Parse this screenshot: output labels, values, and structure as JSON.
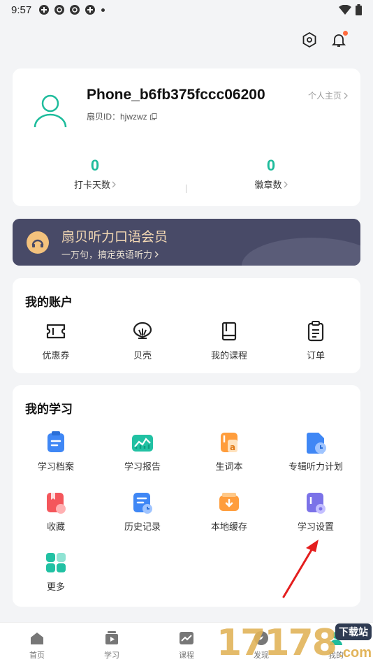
{
  "status_bar": {
    "time": "9:57"
  },
  "profile": {
    "username": "Phone_b6fb375fccc06200",
    "id_label": "扇贝ID：hjwzwz",
    "homepage_label": "个人主页",
    "stats": [
      {
        "value": "0",
        "label": "打卡天数"
      },
      {
        "value": "0",
        "label": "徽章数"
      }
    ]
  },
  "vip": {
    "title": "扇贝听力口语会员",
    "subtitle": "一万句，搞定英语听力"
  },
  "account": {
    "title": "我的账户",
    "items": [
      {
        "label": "优惠券",
        "icon": "ticket-icon"
      },
      {
        "label": "贝壳",
        "icon": "shell-icon"
      },
      {
        "label": "我的课程",
        "icon": "book-icon"
      },
      {
        "label": "订单",
        "icon": "clipboard-icon"
      }
    ]
  },
  "study": {
    "title": "我的学习",
    "items": [
      {
        "label": "学习档案",
        "icon": "archive-icon"
      },
      {
        "label": "学习报告",
        "icon": "report-icon"
      },
      {
        "label": "生词本",
        "icon": "vocabulary-icon"
      },
      {
        "label": "专辑听力计划",
        "icon": "listening-plan-icon"
      },
      {
        "label": "收藏",
        "icon": "favorites-icon"
      },
      {
        "label": "历史记录",
        "icon": "history-icon"
      },
      {
        "label": "本地缓存",
        "icon": "local-cache-icon"
      },
      {
        "label": "学习设置",
        "icon": "study-settings-icon"
      },
      {
        "label": "更多",
        "icon": "more-icon"
      }
    ]
  },
  "tabs": [
    {
      "label": "首页",
      "icon": "home-icon"
    },
    {
      "label": "学习",
      "icon": "play-icon"
    },
    {
      "label": "课程",
      "icon": "chart-icon"
    },
    {
      "label": "发现",
      "icon": "compass-icon"
    },
    {
      "label": "我的",
      "icon": "profile-icon"
    }
  ],
  "watermark": {
    "number": "17178",
    "badge": "下载站",
    "domain": ".com"
  },
  "colors": {
    "accent": "#1ebc9c",
    "vip_bg": "#484a67",
    "vip_gold": "#f4d9b4"
  }
}
